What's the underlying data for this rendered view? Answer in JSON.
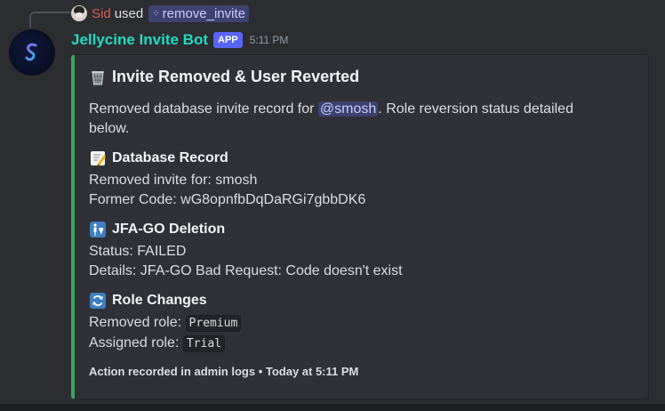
{
  "reply": {
    "user": "Sid",
    "used": "used",
    "command": "remove_invite"
  },
  "message": {
    "bot_name": "Jellycine Invite Bot",
    "badge": "APP",
    "time": "5:11 PM"
  },
  "embed": {
    "accent_color": "#3ba55c",
    "title_icon": "wastebasket-icon",
    "title": "Invite Removed & User Reverted",
    "desc_prefix": "Removed database invite record for ",
    "mention": "@smosh",
    "desc_suffix": ". Role reversion status detailed below.",
    "fields": {
      "db": {
        "icon": "memo-icon",
        "name": "Database Record",
        "line1": "Removed invite for: smosh",
        "line2": "Former Code: wG8opnfbDqDaRGi7gbbDK6"
      },
      "jfa": {
        "icon": "restroom-icon",
        "name": "JFA-GO Deletion",
        "line1": "Status: FAILED",
        "line2": "Details: JFA-GO Bad Request: Code doesn't exist"
      },
      "roles": {
        "icon": "refresh-icon",
        "name": "Role Changes",
        "removed_label": "Removed role: ",
        "removed_value": "Premium",
        "assigned_label": "Assigned role: ",
        "assigned_value": "Trial"
      }
    },
    "footer": "Action recorded in admin logs • Today at 5:11 PM"
  }
}
